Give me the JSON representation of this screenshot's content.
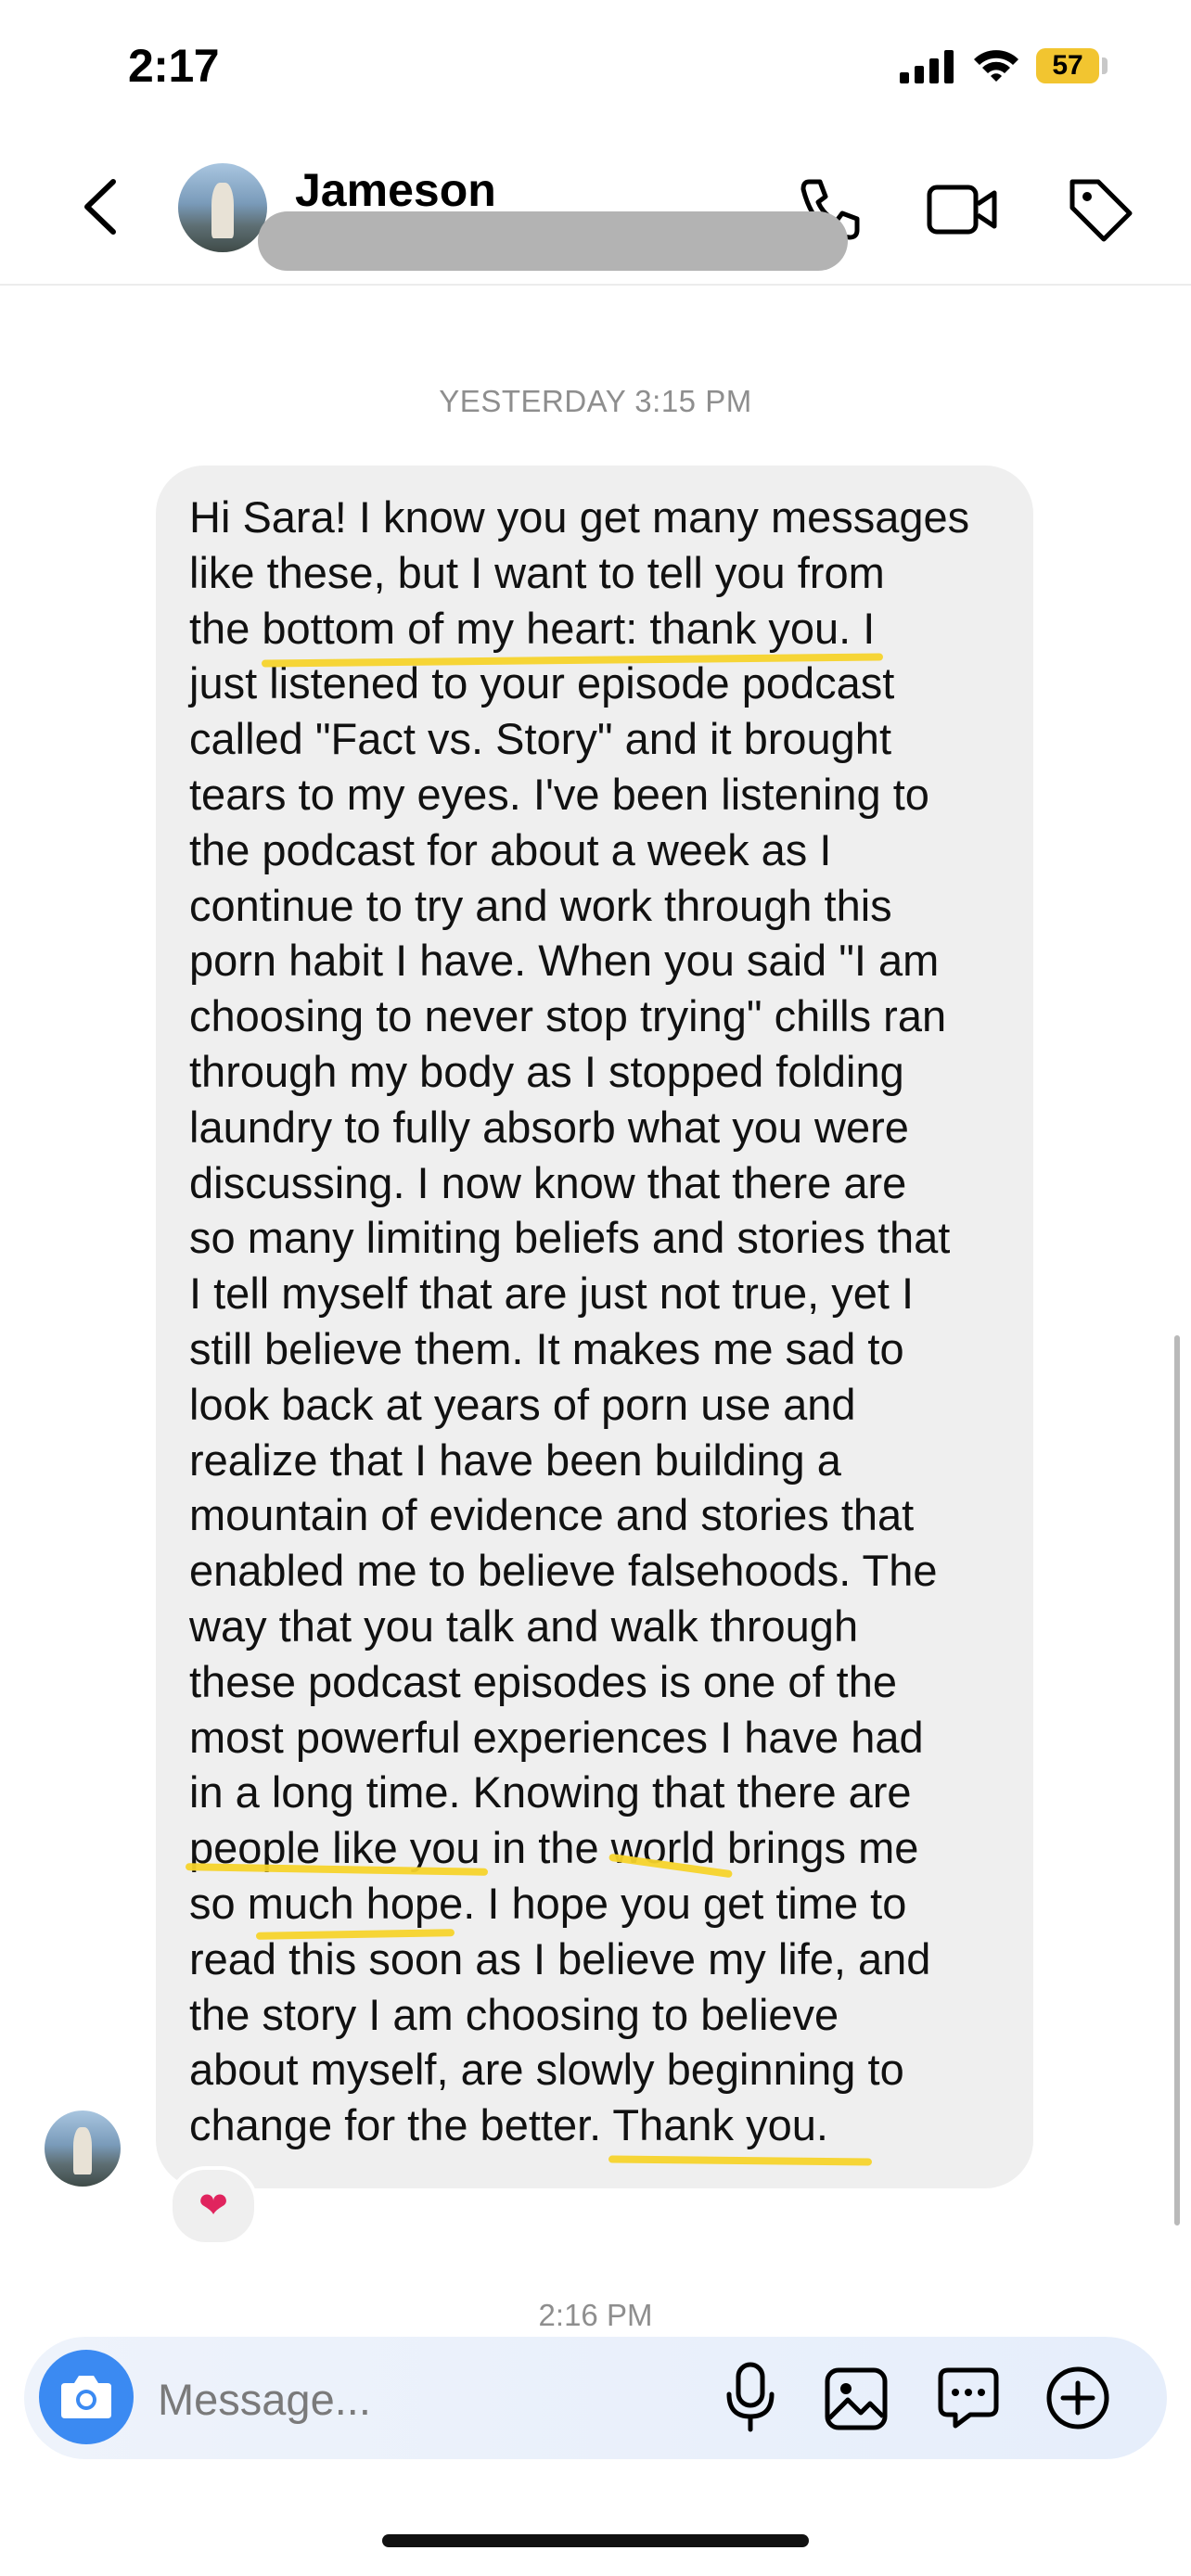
{
  "status_bar": {
    "time": "2:17",
    "battery": "57"
  },
  "header": {
    "contact_name": "Jameson"
  },
  "conversation": {
    "timestamp_earlier": "YESTERDAY 3:15 PM",
    "message": {
      "text": "Hi Sara! I know you get many messages\nlike these, but I want to tell you from\nthe bottom of my heart: thank you. I\njust listened to your episode podcast\ncalled \"Fact vs. Story\" and it brought\ntears to my eyes. I've been listening to\nthe podcast for about a week as I\ncontinue to try and work through this\nporn habit I have. When you said \"I am\nchoosing to never stop trying\" chills ran\nthrough my body as I stopped folding\nlaundry to fully absorb what you were\ndiscussing. I now know that there are\nso many limiting beliefs and stories that\nI tell myself that are just not true, yet I\nstill believe them. It makes me sad to\nlook back at years of porn use and\nrealize that I have been building a\nmountain of evidence and stories that\nenabled me to believe falsehoods. The\nway that you talk and walk through\nthese podcast episodes is one of the\nmost powerful experiences I have had\nin a long time. Knowing that there are\npeople like you in the world brings me\nso much hope. I hope you get time to\nread this soon as I believe my life, and\nthe story I am choosing to believe\nabout myself, are slowly beginning to\nchange for the better. Thank you.",
      "reaction": "heart"
    },
    "timestamp_latest": "2:16 PM"
  },
  "composer": {
    "placeholder": "Message..."
  },
  "icons": {
    "back": "chevron-left-icon",
    "call": "phone-icon",
    "video": "video-camera-icon",
    "tag": "tag-icon",
    "camera": "camera-icon",
    "mic": "microphone-icon",
    "gallery": "image-icon",
    "sticker": "chat-bubble-icon",
    "add": "plus-circle-icon"
  },
  "colors": {
    "accent": "#3b8af2",
    "highlight": "#f6d32b",
    "bubble": "#efefef",
    "battery": "#f2c530"
  }
}
